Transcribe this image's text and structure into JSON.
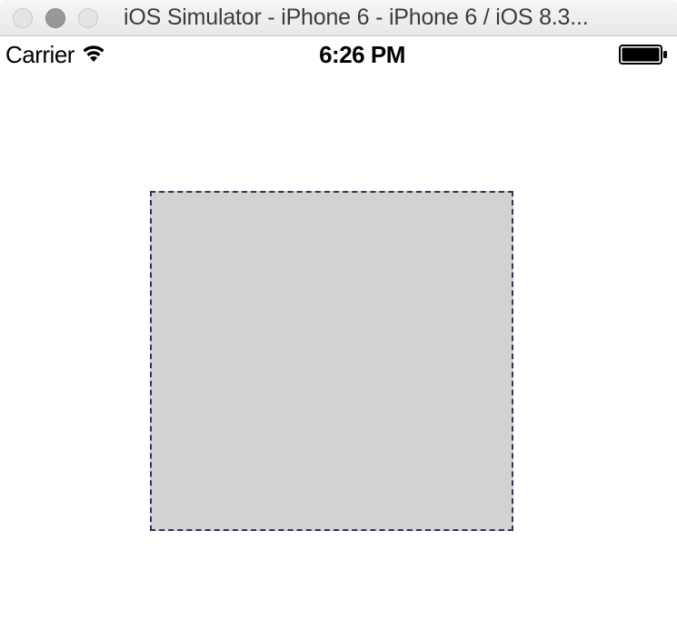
{
  "window": {
    "title": "iOS Simulator - iPhone 6 - iPhone 6 / iOS 8.3..."
  },
  "statusbar": {
    "carrier": "Carrier",
    "time": "6:26 PM"
  }
}
